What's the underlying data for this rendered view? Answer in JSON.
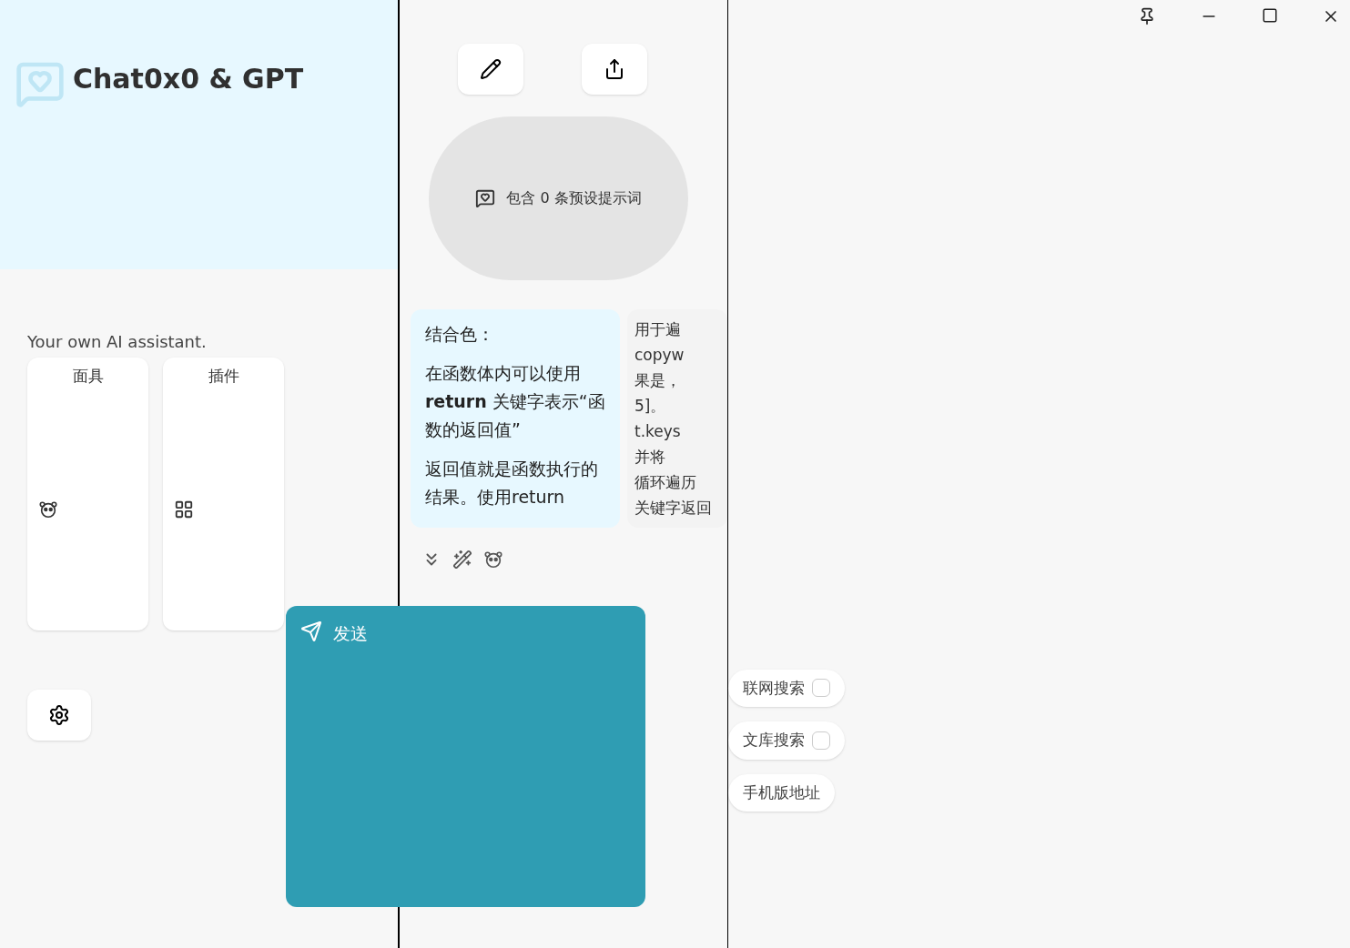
{
  "sidebar": {
    "title": "Chat0x0 & GPT",
    "subtitle": "Your own AI assistant.",
    "buttons": [
      {
        "kind": "mask",
        "label": "面具"
      },
      {
        "kind": "plugin",
        "label": "插件"
      }
    ]
  },
  "chat": {
    "prompt_hint": "包含 0 条预设提示词",
    "messages": [
      {
        "kind": "user",
        "paragraphs": [
          "结合色：",
          "在函数体内可以使用 **return** 关键字表示“函数的返回值”",
          "返回值就是函数执行的结果。使用return"
        ]
      },
      {
        "kind": "bot",
        "paragraphs": [
          "用于遍",
          "copyw",
          "果是，",
          "5]。",
          "t.keys",
          "并将",
          "循环遍历",
          "关键字返回"
        ]
      }
    ],
    "send_label": "发送",
    "chips": [
      {
        "label": "联网搜索",
        "checked": false
      },
      {
        "label": "文库搜索",
        "checked": false
      },
      {
        "label": "手机版地址"
      }
    ]
  }
}
